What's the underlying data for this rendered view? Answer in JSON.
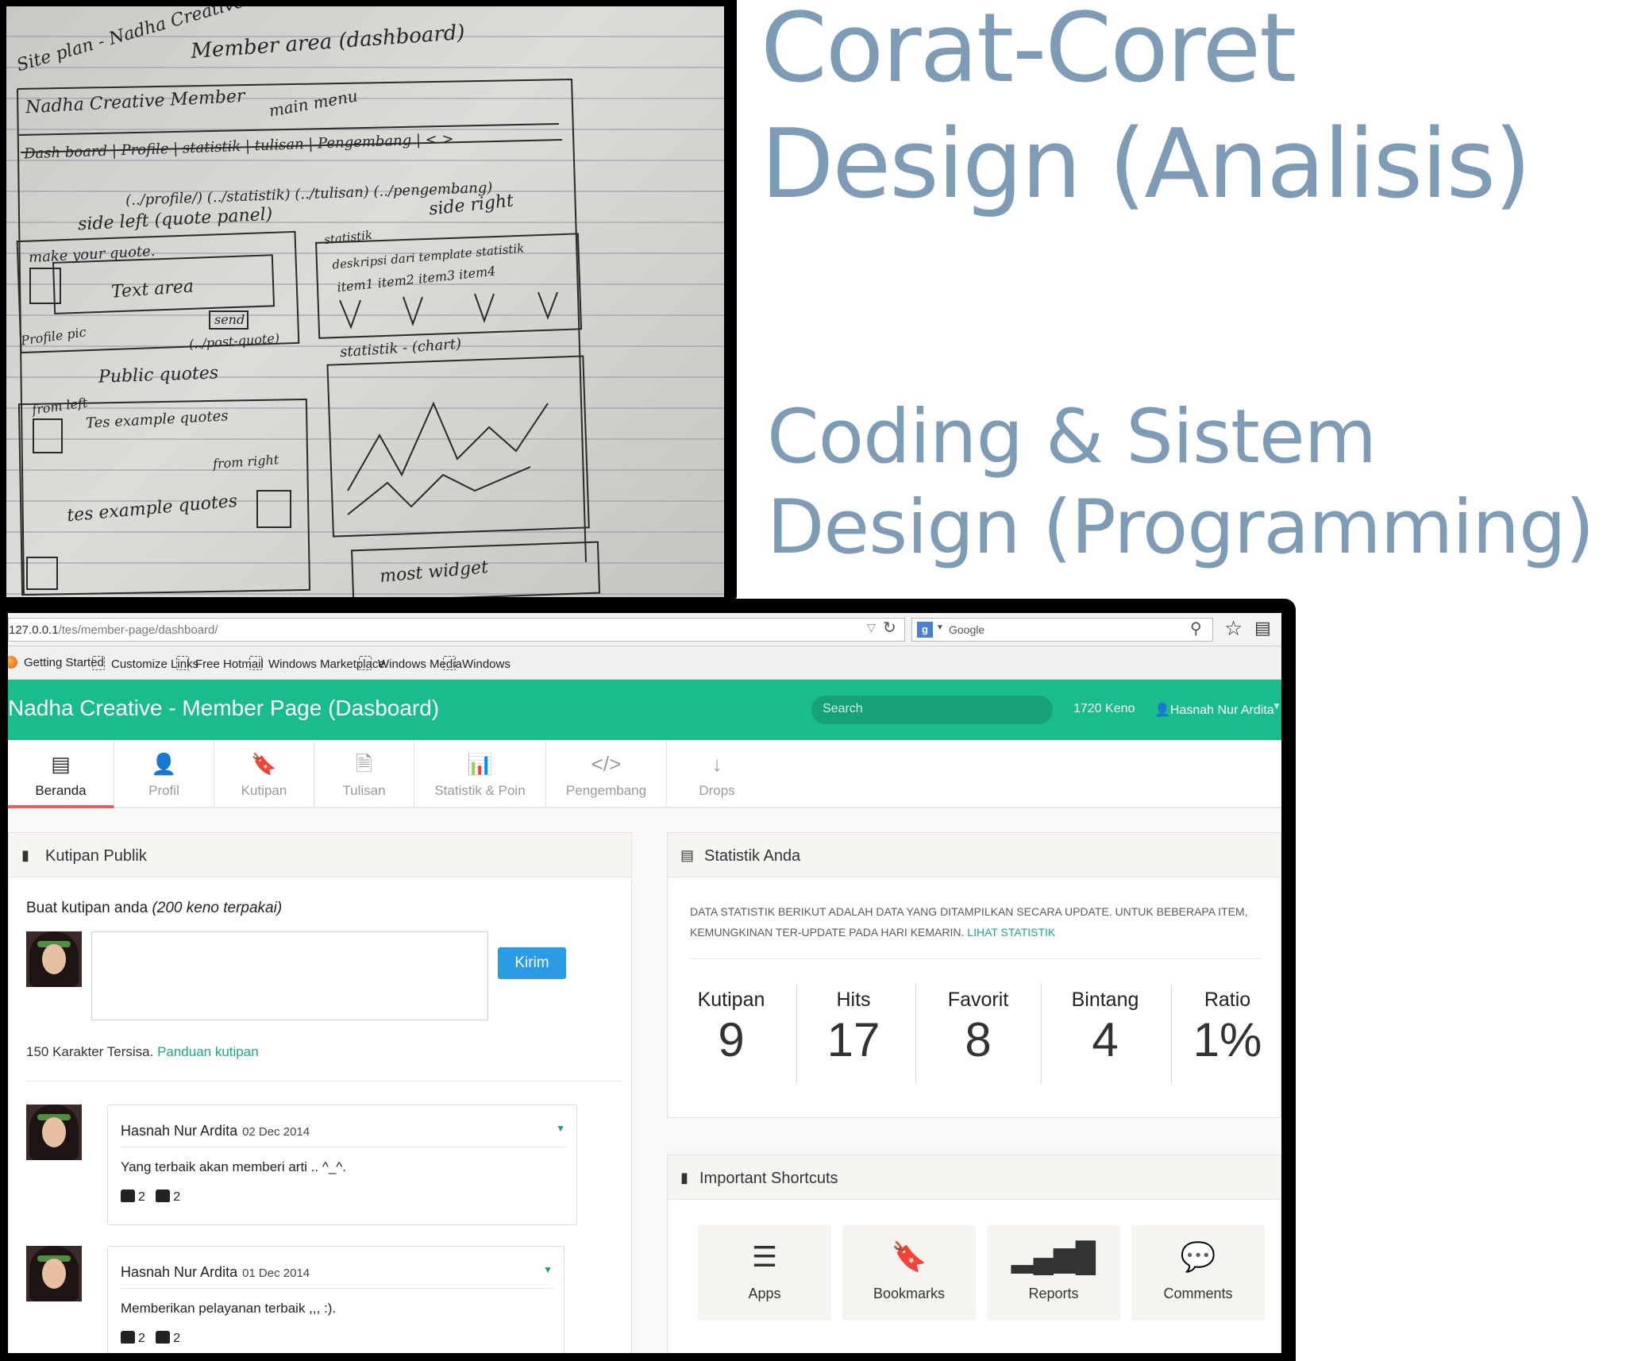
{
  "slide": {
    "heading_analysis": [
      "Corat-Coret",
      "Design (Analisis)"
    ],
    "heading_programming": [
      "Coding & Sistem",
      "Design (Programming)"
    ]
  },
  "sketch": {
    "notes": [
      "Site plan - Nadha Creative",
      "Member area (dashboard)",
      "Nadha Creative Member",
      "main menu",
      "Dash board | Profile | statistik | tulisan | Pengembang | < >",
      "(../profile/)   (../statistik)   (../tulisan)   (../pengembang)",
      "side left (quote panel)",
      "side right",
      "make your quote.",
      "Text area",
      "send",
      "Profile pic",
      "(../post-quote)",
      "statistik",
      "deskripsi dari template statistik",
      "item1  item2  item3  item4",
      "statistik - (chart)",
      "Public quotes",
      "from left",
      "Tes example quotes",
      "from right",
      "tes example quotes",
      "most widget"
    ]
  },
  "browser": {
    "url": {
      "host": "127.0.0.1",
      "path": "/tes/member-page/dashboard/"
    },
    "search_engine": "Google",
    "bookmarks": [
      "Getting Started",
      "Customize Links",
      "Free Hotmail",
      "Windows Marketplace",
      "Windows Media",
      "Windows"
    ]
  },
  "app": {
    "title": "Nadha Creative - Member Page (Dasboard)",
    "search_placeholder": "Search",
    "keno": "1720 Keno",
    "user": "Hasnah Nur Ardita",
    "tabs": [
      {
        "label": "Beranda",
        "icon": "newspaper-icon",
        "active": true
      },
      {
        "label": "Profil",
        "icon": "user-icon",
        "active": false
      },
      {
        "label": "Kutipan",
        "icon": "bookmark-icon",
        "active": false
      },
      {
        "label": "Tulisan",
        "icon": "file-icon",
        "active": false
      },
      {
        "label": "Statistik & Poin",
        "icon": "bar-chart-icon",
        "active": false
      },
      {
        "label": "Pengembang",
        "icon": "code-icon",
        "active": false
      },
      {
        "label": "Drops",
        "icon": "arrow-down-icon",
        "active": false
      }
    ],
    "quotes_panel": {
      "title": "Kutipan Publik",
      "compose_heading": "Buat kutipan anda",
      "compose_cost": "(200 keno terpakai)",
      "send_label": "Kirim",
      "remaining_text": "150 Karakter Tersisa.",
      "guide_link": "Panduan kutipan",
      "posts": [
        {
          "author": "Hasnah Nur Ardita",
          "date": "02 Dec 2014",
          "text": "Yang terbaik akan memberi arti .. ^_^.",
          "likes": "2",
          "shares": "2"
        },
        {
          "author": "Hasnah Nur Ardita",
          "date": "01 Dec 2014",
          "text": "Memberikan pelayanan terbaik ,,, :).",
          "likes": "2",
          "shares": "2"
        }
      ]
    },
    "stats_panel": {
      "title": "Statistik Anda",
      "description": "DATA STATISTIK BERIKUT ADALAH DATA YANG DITAMPILKAN SECARA UPDATE. UNTUK BEBERAPA ITEM, KEMUNGKINAN TER-UPDATE PADA HARI KEMARIN.",
      "link": "LIHAT STATISTIK",
      "stats": [
        {
          "label": "Kutipan",
          "value": "9"
        },
        {
          "label": "Hits",
          "value": "17"
        },
        {
          "label": "Favorit",
          "value": "8"
        },
        {
          "label": "Bintang",
          "value": "4"
        },
        {
          "label": "Ratio",
          "value": "1%"
        }
      ]
    },
    "shortcuts_panel": {
      "title": "Important Shortcuts",
      "items": [
        {
          "label": "Apps",
          "icon": "list-icon"
        },
        {
          "label": "Bookmarks",
          "icon": "bookmark-icon"
        },
        {
          "label": "Reports",
          "icon": "signal-bars-icon"
        },
        {
          "label": "Comments",
          "icon": "speech-bubble-icon"
        }
      ]
    }
  },
  "colors": {
    "heading": "#7f9cb6",
    "app_green": "#1abc8c",
    "link_teal": "#1aa88a",
    "button_blue": "#2b9be4",
    "active_tab_underline": "#e46060"
  }
}
